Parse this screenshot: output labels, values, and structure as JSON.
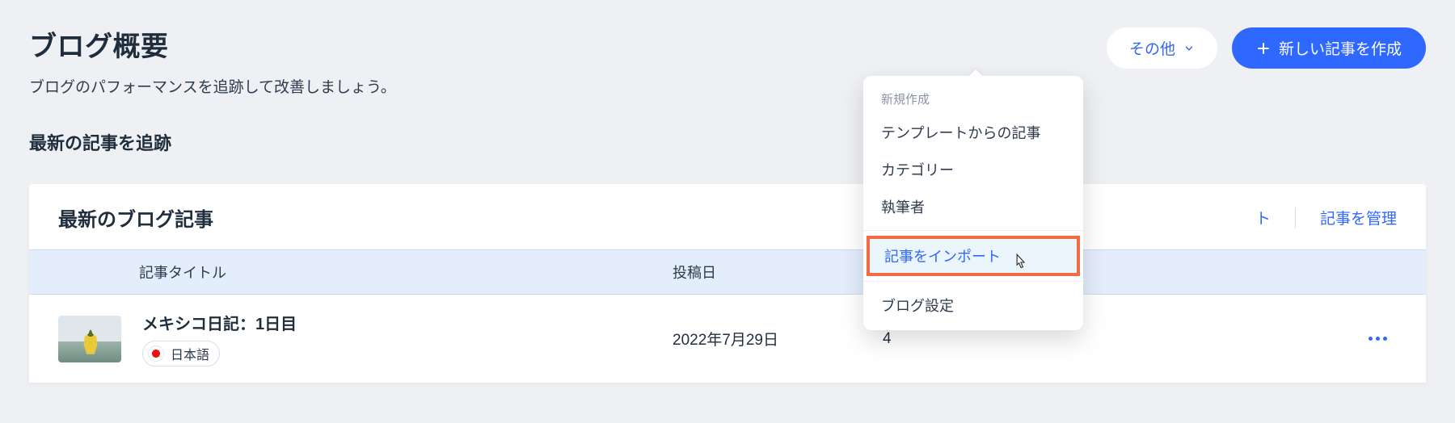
{
  "header": {
    "title": "ブログ概要",
    "subtitle": "ブログのパフォーマンスを追跡して改善しましょう。"
  },
  "actions": {
    "other_label": "その他",
    "new_post_label": "新しい記事を作成"
  },
  "section": {
    "track_latest": "最新の記事を追跡"
  },
  "card": {
    "title": "最新のブログ記事",
    "link_truncated": "ト",
    "link_manage": "記事を管理"
  },
  "table": {
    "headers": {
      "title": "記事タイトル",
      "date": "投稿日"
    },
    "rows": [
      {
        "title": "メキシコ日記：1日目",
        "language": "日本語",
        "date": "2022年7月29日",
        "value": "4"
      }
    ]
  },
  "dropdown": {
    "heading": "新規作成",
    "items": {
      "template": "テンプレートからの記事",
      "category": "カテゴリー",
      "author": "執筆者",
      "import": "記事をインポート",
      "settings": "ブログ設定"
    }
  }
}
